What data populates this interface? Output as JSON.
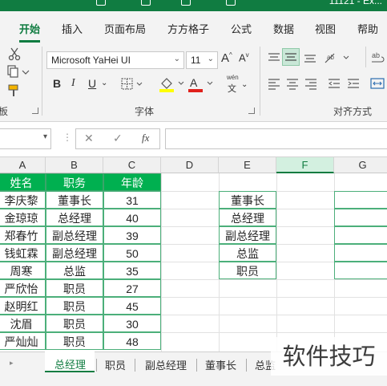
{
  "titlebar": {
    "title": "11121 - Ex..."
  },
  "ribbon_tabs": [
    "开始",
    "插入",
    "页面布局",
    "方方格子",
    "公式",
    "数据",
    "视图",
    "帮助"
  ],
  "font": {
    "name": "Microsoft YaHei UI",
    "size": "11",
    "group_label": "字体",
    "bold": "B",
    "italic": "I",
    "underline": "U",
    "wen_label": "wén",
    "wen_char": "文"
  },
  "clipboard": {
    "group_label": "板"
  },
  "alignment": {
    "group_label": "对齐方式"
  },
  "formula_bar": {
    "cancel": "✕",
    "confirm": "✓",
    "fx": "fx"
  },
  "columns": [
    "A",
    "B",
    "C",
    "D",
    "E",
    "F",
    "G"
  ],
  "table": {
    "headers": [
      "姓名",
      "职务",
      "年龄"
    ],
    "rows": [
      [
        "李庆黎",
        "董事长",
        "31"
      ],
      [
        "金琼琼",
        "总经理",
        "40"
      ],
      [
        "郑春竹",
        "副总经理",
        "39"
      ],
      [
        "钱虹霖",
        "副总经理",
        "50"
      ],
      [
        "周寒",
        "总监",
        "35"
      ],
      [
        "严欣怡",
        "职员",
        "27"
      ],
      [
        "赵明红",
        "职员",
        "45"
      ],
      [
        "沈眉",
        "职员",
        "30"
      ],
      [
        "严灿灿",
        "职员",
        "48"
      ]
    ]
  },
  "positions": [
    "董事长",
    "总经理",
    "副总经理",
    "总监",
    "职员"
  ],
  "sheet_tabs": [
    "总经理",
    "职员",
    "副总经理",
    "董事长",
    "总监"
  ],
  "watermark": "软件技巧",
  "colors": {
    "accent": "#107c41",
    "header_fill": "#00b050"
  }
}
